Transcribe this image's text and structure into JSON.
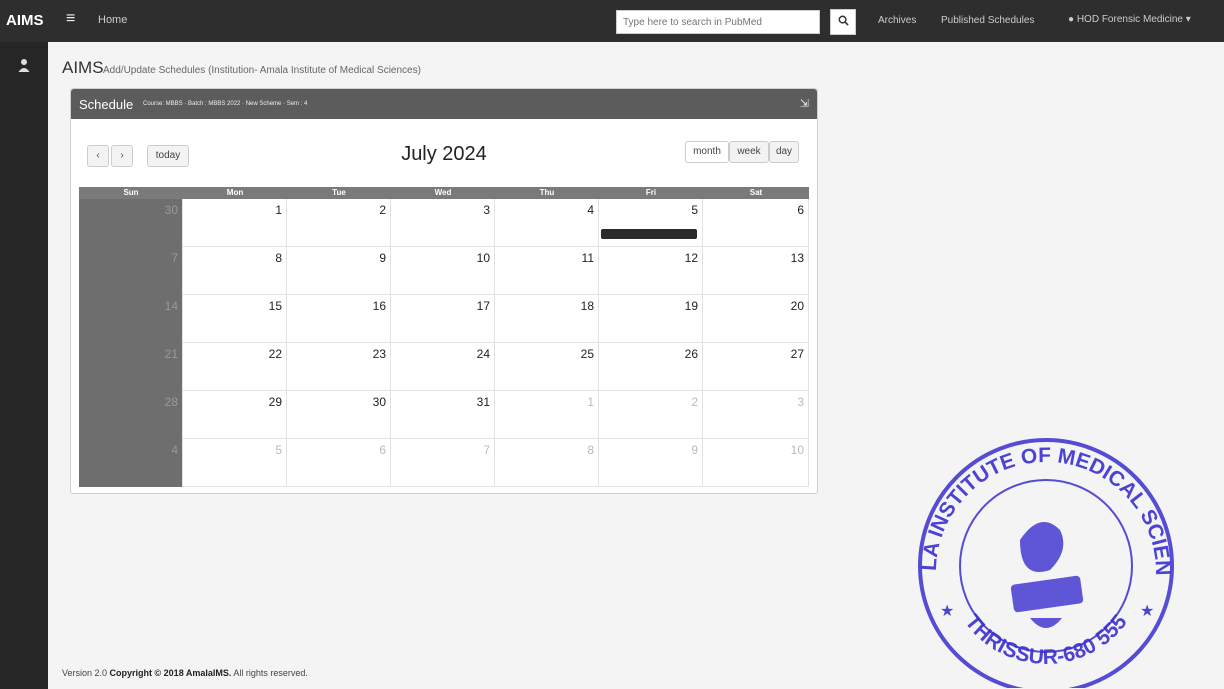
{
  "header": {
    "brand": "AIMS",
    "menu_icon": "hamburger-icon",
    "home_label": "Home",
    "search_placeholder": "Type here to search in PubMed",
    "search_icon": "search-icon",
    "links": [
      "Archives",
      "Published Schedules"
    ],
    "user_label": "HOD Forensic Medicine ▾",
    "user_icon": "user-icon"
  },
  "sidebar": {
    "icon": "person-icon"
  },
  "page": {
    "title": "AIMS",
    "subtitle": "Add/Update Schedules (Institution- Amala Institute of Medical Sciences)"
  },
  "panel": {
    "title": "Schedule",
    "meta": "Course: MBBS · Batch : MBBS 2022 · New Scheme · Sem : 4",
    "collapse_icon": "external-link-icon"
  },
  "calendar": {
    "prev_icon": "chevron-left-icon",
    "next_icon": "chevron-right-icon",
    "prev_label": "‹",
    "next_label": "›",
    "today_label": "today",
    "month_title": "July 2024",
    "views": [
      "month",
      "week",
      "day"
    ],
    "days_of_week": [
      "Sun",
      "Mon",
      "Tue",
      "Wed",
      "Thu",
      "Fri",
      "Sat"
    ],
    "weeks": [
      [
        {
          "d": "30",
          "o": true
        },
        {
          "d": "1"
        },
        {
          "d": "2"
        },
        {
          "d": "3"
        },
        {
          "d": "4"
        },
        {
          "d": "5",
          "event": true
        },
        {
          "d": "6"
        }
      ],
      [
        {
          "d": "7"
        },
        {
          "d": "8"
        },
        {
          "d": "9"
        },
        {
          "d": "10"
        },
        {
          "d": "11"
        },
        {
          "d": "12"
        },
        {
          "d": "13"
        }
      ],
      [
        {
          "d": "14"
        },
        {
          "d": "15"
        },
        {
          "d": "16"
        },
        {
          "d": "17"
        },
        {
          "d": "18"
        },
        {
          "d": "19"
        },
        {
          "d": "20"
        }
      ],
      [
        {
          "d": "21"
        },
        {
          "d": "22"
        },
        {
          "d": "23"
        },
        {
          "d": "24"
        },
        {
          "d": "25"
        },
        {
          "d": "26"
        },
        {
          "d": "27"
        }
      ],
      [
        {
          "d": "28"
        },
        {
          "d": "29"
        },
        {
          "d": "30"
        },
        {
          "d": "31"
        },
        {
          "d": "1",
          "o": true
        },
        {
          "d": "2",
          "o": true
        },
        {
          "d": "3",
          "o": true
        }
      ],
      [
        {
          "d": "4",
          "o": true
        },
        {
          "d": "5",
          "o": true
        },
        {
          "d": "6",
          "o": true
        },
        {
          "d": "7",
          "o": true
        },
        {
          "d": "8",
          "o": true
        },
        {
          "d": "9",
          "o": true
        },
        {
          "d": "10",
          "o": true
        }
      ]
    ]
  },
  "footer": {
    "version": "Version 2.0",
    "copyright": "Copyright © 2018 AmalaIMS.",
    "rights": "All rights reserved."
  },
  "stamp": {
    "top_text": "AMALA INSTITUTE OF MEDICAL SCIENCES",
    "bottom_text": "THRISSUR-680 555",
    "color": "#3a2fd0"
  }
}
